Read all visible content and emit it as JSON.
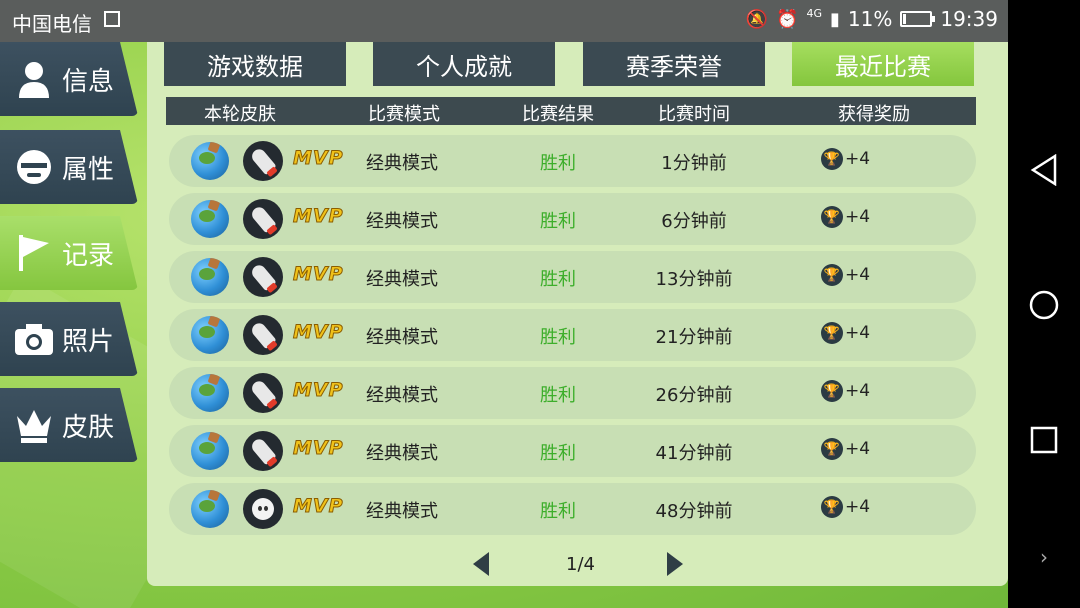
{
  "status_bar": {
    "carrier": "中国电信",
    "network": "4G",
    "battery_percent": "11%",
    "battery_level": 0.11,
    "time": "19:39"
  },
  "side_menu": [
    {
      "label": "信息",
      "icon": "person-icon",
      "active": false
    },
    {
      "label": "属性",
      "icon": "face-icon",
      "active": false
    },
    {
      "label": "记录",
      "icon": "flag-icon",
      "active": true
    },
    {
      "label": "照片",
      "icon": "camera-icon",
      "active": false
    },
    {
      "label": "皮肤",
      "icon": "crown-icon",
      "active": false
    }
  ],
  "tabs": [
    {
      "label": "游戏数据",
      "active": false
    },
    {
      "label": "个人成就",
      "active": false
    },
    {
      "label": "赛季荣誉",
      "active": false
    },
    {
      "label": "最近比赛",
      "active": true
    }
  ],
  "table": {
    "headers": [
      "本轮皮肤",
      "比赛模式",
      "比赛结果",
      "比赛时间",
      "获得奖励"
    ],
    "rows": [
      {
        "skin": "planet",
        "avatar": "rocket-icon",
        "badge": "MVP",
        "mode": "经典模式",
        "result": "胜利",
        "time": "1分钟前",
        "reward": "+4"
      },
      {
        "skin": "planet",
        "avatar": "rocket-icon",
        "badge": "MVP",
        "mode": "经典模式",
        "result": "胜利",
        "time": "6分钟前",
        "reward": "+4"
      },
      {
        "skin": "planet",
        "avatar": "rocket-icon",
        "badge": "MVP",
        "mode": "经典模式",
        "result": "胜利",
        "time": "13分钟前",
        "reward": "+4"
      },
      {
        "skin": "planet",
        "avatar": "rocket-icon",
        "badge": "MVP",
        "mode": "经典模式",
        "result": "胜利",
        "time": "21分钟前",
        "reward": "+4"
      },
      {
        "skin": "planet",
        "avatar": "rocket-icon",
        "badge": "MVP",
        "mode": "经典模式",
        "result": "胜利",
        "time": "26分钟前",
        "reward": "+4"
      },
      {
        "skin": "planet",
        "avatar": "rocket-icon",
        "badge": "MVP",
        "mode": "经典模式",
        "result": "胜利",
        "time": "41分钟前",
        "reward": "+4"
      },
      {
        "skin": "planet",
        "avatar": "ghost-icon",
        "badge": "MVP",
        "mode": "经典模式",
        "result": "胜利",
        "time": "48分钟前",
        "reward": "+4"
      }
    ]
  },
  "pagination": {
    "text": "1/4"
  },
  "colors": {
    "accent": "#8fd14a",
    "dark": "#3b4a52",
    "win": "#3dae2b"
  }
}
